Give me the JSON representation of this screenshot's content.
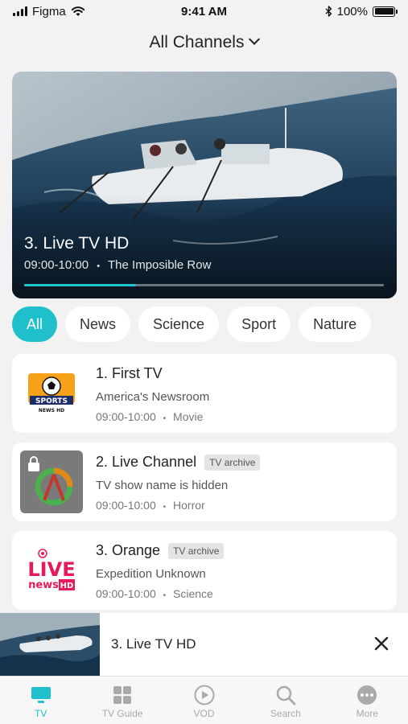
{
  "status": {
    "carrier": "Figma",
    "time": "9:41 AM",
    "battery": "100%"
  },
  "header": {
    "title": "All Channels"
  },
  "hero": {
    "title": "3. Live TV HD",
    "time": "09:00-10:00",
    "show": "The Imposible Row",
    "progress": 0.31
  },
  "categories": [
    "All",
    "News",
    "Science",
    "Sport",
    "Nature"
  ],
  "channels": [
    {
      "name": "1. First TV",
      "badge": "",
      "show": "America's Newsroom",
      "time": "09:00-10:00",
      "genre": "Movie",
      "logo": "sports-news-hd-logo",
      "logo_text_top": "SPORTS",
      "logo_text_bottom": "NEWS HD"
    },
    {
      "name": "2. Live Channel",
      "badge": "TV archive",
      "show": "TV show name is hidden",
      "time": "09:00-10:00",
      "genre": "Horror",
      "logo": "locked-channel-logo"
    },
    {
      "name": "3. Orange",
      "badge": "TV archive",
      "show": "Expedition Unknown",
      "time": "09:00-10:00",
      "genre": "Science",
      "logo": "live-news-hd-logo",
      "logo_text_top": "LIVE",
      "logo_text_bottom": "news",
      "logo_text_hd": "HD"
    }
  ],
  "mini_player": {
    "title": "3. Live TV HD"
  },
  "tabs": [
    {
      "label": "TV",
      "icon": "tv-icon",
      "active": true
    },
    {
      "label": "TV Guide",
      "icon": "grid-icon",
      "active": false
    },
    {
      "label": "VOD",
      "icon": "play-circle-icon",
      "active": false
    },
    {
      "label": "Search",
      "icon": "search-icon",
      "active": false
    },
    {
      "label": "More",
      "icon": "more-icon",
      "active": false
    }
  ],
  "colors": {
    "accent": "#1fc0cb"
  },
  "separator": "•"
}
